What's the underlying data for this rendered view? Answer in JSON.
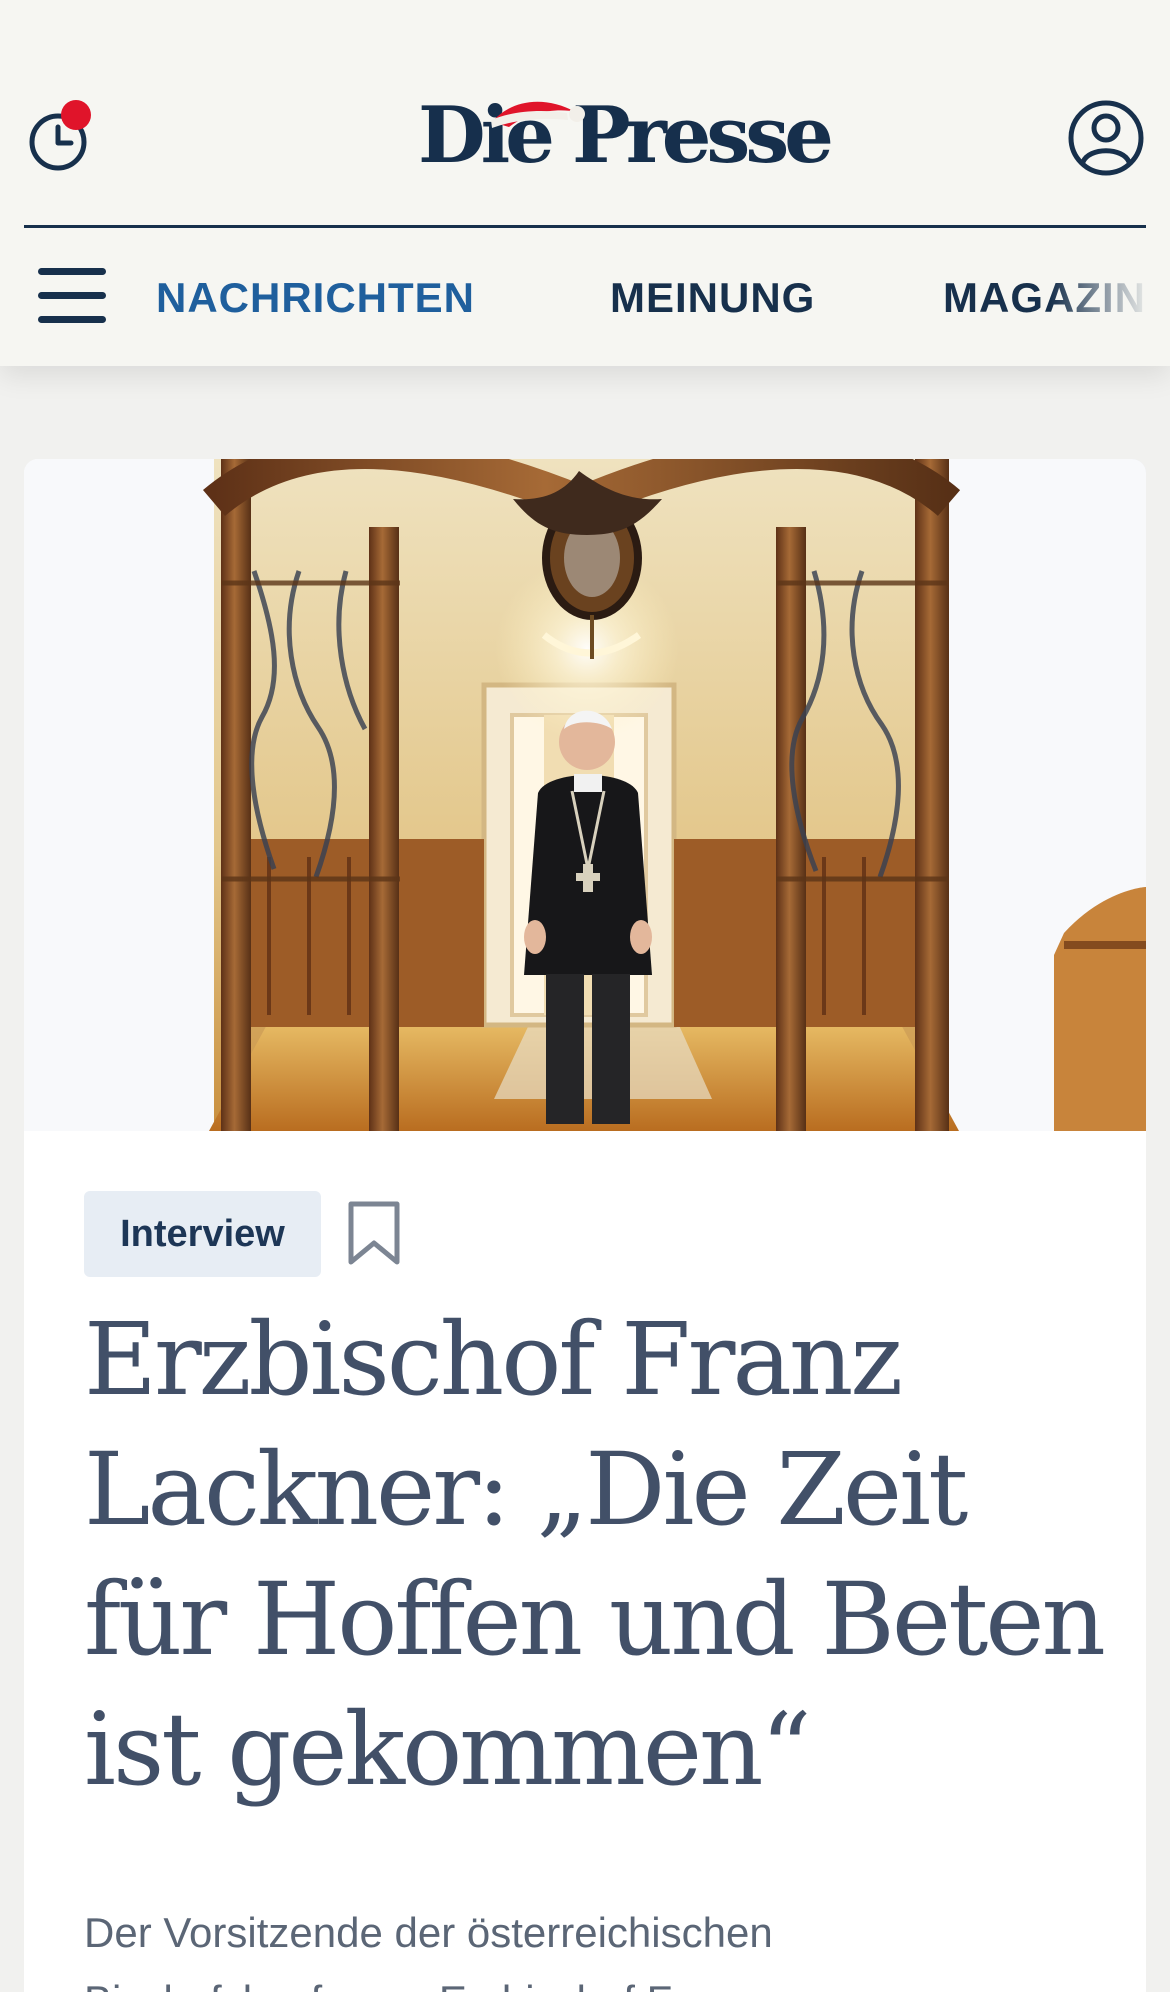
{
  "header": {
    "logo": "Die Presse"
  },
  "nav": {
    "items": [
      {
        "label": "NACHRICHTEN",
        "active": true
      },
      {
        "label": "MEINUNG",
        "active": false
      },
      {
        "label": "MAGAZIN",
        "active": false
      }
    ]
  },
  "article": {
    "tag": "Interview",
    "headline": "Erzbischof Franz Lackner: „Die Zeit für Hoffen und Beten ist gekommen“",
    "lead": "Der Vorsitzende der österreichischen\nBischofskonferenz Erzbischof Franz"
  },
  "icons": {
    "history": "history-clock-icon",
    "notification": "notification-dot-icon",
    "account": "account-icon",
    "menu": "menu-icon",
    "bookmark": "bookmark-icon"
  },
  "colors": {
    "brand_navy": "#17304c",
    "active_nav_blue": "#1f5f9d",
    "notification_red": "#e0142a",
    "headline": "#425068",
    "tag_background": "#e7edf4"
  }
}
